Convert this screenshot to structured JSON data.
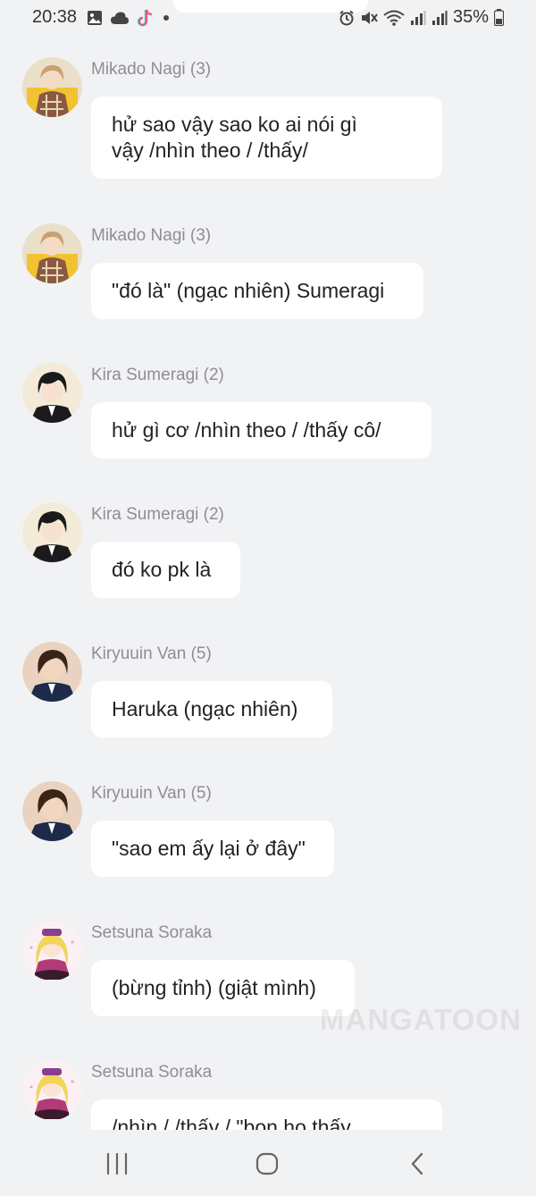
{
  "status_bar": {
    "time": "20:38",
    "battery_percent": "35%",
    "left_icons": [
      "gallery-icon",
      "cloud-icon",
      "tiktok-icon",
      "dot-icon"
    ],
    "right_icons": [
      "alarm-icon",
      "mute-icon",
      "wifi-icon",
      "signal-icon",
      "signal-icon",
      "battery-icon"
    ]
  },
  "messages": [
    {
      "sender": "Mikado Nagi (3)",
      "text_lines": [
        "hử sao vậy sao ko ai nói gì",
        "vậy /nhìn theo / /thấy/"
      ],
      "avatar": "mikado-nagi-avatar"
    },
    {
      "sender": "Mikado Nagi (3)",
      "text_lines": [
        "\"đó là\" (ngạc nhiên) Sumeragi"
      ],
      "avatar": "mikado-nagi-avatar"
    },
    {
      "sender": "Kira Sumeragi (2)",
      "text_lines": [
        "hử gì cơ /nhìn theo / /thấy cô/"
      ],
      "avatar": "kira-sumeragi-avatar"
    },
    {
      "sender": "Kira Sumeragi (2)",
      "text_lines": [
        "đó ko pk là"
      ],
      "avatar": "kira-sumeragi-avatar"
    },
    {
      "sender": "Kiryuuin Van (5)",
      "text_lines": [
        "Haruka (ngạc nhiên)"
      ],
      "avatar": "kiryuuin-van-avatar"
    },
    {
      "sender": "Kiryuuin Van (5)",
      "text_lines": [
        "\"sao em ấy lại ở đây\""
      ],
      "avatar": "kiryuuin-van-avatar"
    },
    {
      "sender": "Setsuna Soraka",
      "text_lines": [
        "(bừng tỉnh) (giật mình)"
      ],
      "avatar": "setsuna-soraka-avatar"
    },
    {
      "sender": "Setsuna Soraka",
      "text_lines": [
        "/nhìn / /thấy / \"bọn họ thấy"
      ],
      "avatar": "setsuna-soraka-avatar"
    }
  ],
  "watermark": "MANGATOON",
  "nav_bar": {
    "buttons": [
      "recent-apps-icon",
      "home-icon",
      "back-icon"
    ]
  },
  "colors": {
    "background": "#f1f2f4",
    "bubble": "#ffffff",
    "sender_name": "#8e8e93",
    "message_text": "#222222"
  }
}
